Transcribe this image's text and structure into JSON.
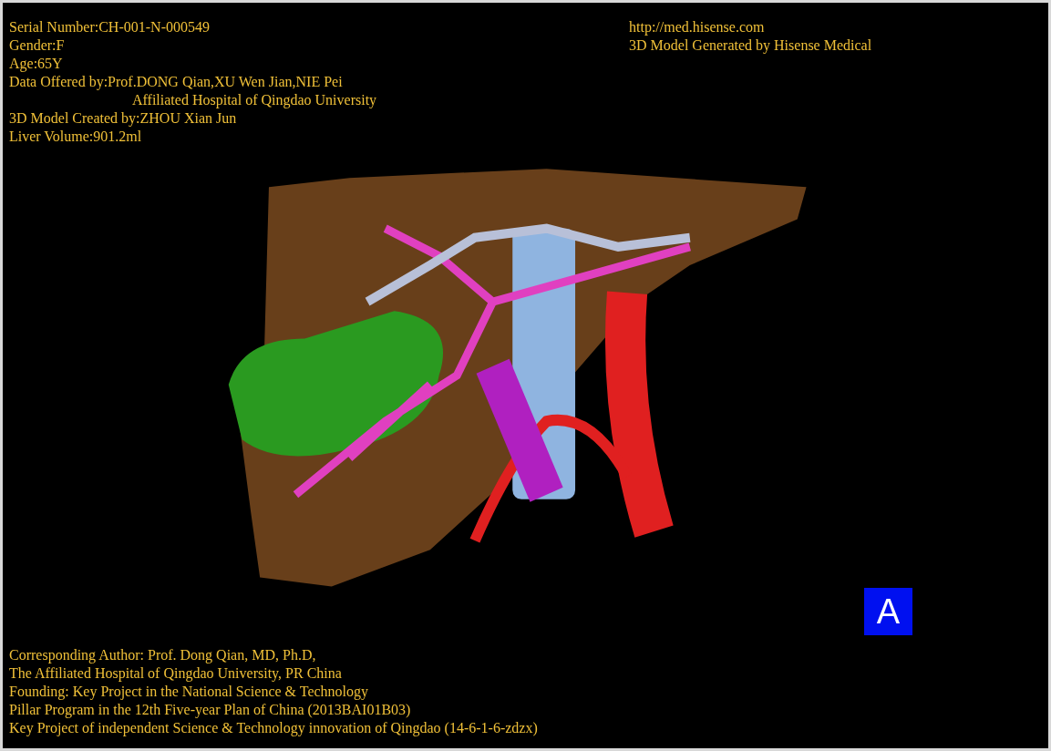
{
  "info_left": [
    {
      "kind": "line",
      "text": "Serial Number:CH-001-N-000549"
    },
    {
      "kind": "line",
      "text": "Gender:F"
    },
    {
      "kind": "line",
      "text": "Age:65Y"
    },
    {
      "kind": "line",
      "text": "Data Offered by:Prof.DONG Qian,XU Wen Jian,NIE Pei"
    },
    {
      "kind": "indent",
      "text": "Affiliated Hospital of Qingdao University"
    },
    {
      "kind": "line",
      "text": "3D Model Created by:ZHOU Xian Jun"
    },
    {
      "kind": "line",
      "text": "Liver Volume:901.2ml"
    }
  ],
  "info_right": [
    "http://med.hisense.com",
    "3D Model Generated by Hisense Medical"
  ],
  "view_label": "A",
  "credits": [
    "Corresponding Author: Prof. Dong Qian, MD, Ph.D,",
    "The Affiliated Hospital of Qingdao University, PR China",
    "Founding: Key Project in the National Science & Technology",
    "Pillar Program in the 12th Five-year Plan of China (2013BAI01B03)",
    "Key Project of independent Science & Technology innovation of Qingdao (14-6-1-6-zdzx)"
  ]
}
